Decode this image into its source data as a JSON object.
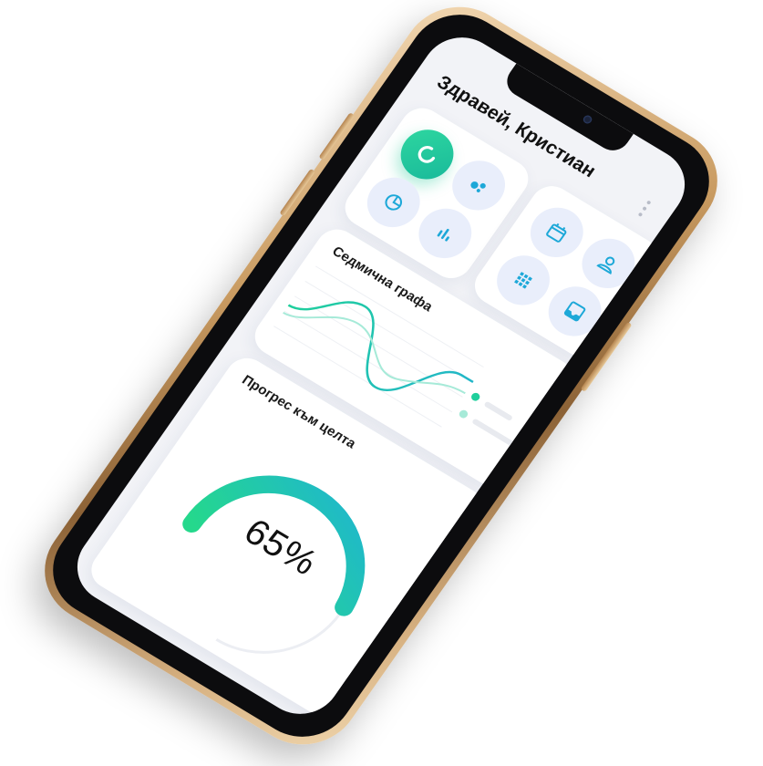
{
  "app": {
    "greeting": "Здравей, Кристиан"
  },
  "colors": {
    "accent_green": "#1fcf9c",
    "accent_teal": "#22b6c9",
    "icon_blue": "#1da8d8",
    "icon_bg": "#e9eefb",
    "frame_gold": "#c99b61"
  },
  "quick_actions_left": [
    {
      "icon": "donut-chart-icon",
      "active": true
    },
    {
      "icon": "bubbles-icon",
      "active": false
    },
    {
      "icon": "pie-chart-icon",
      "active": false
    },
    {
      "icon": "bar-chart-icon",
      "active": false
    }
  ],
  "quick_actions_right": [
    {
      "icon": "calendar-icon"
    },
    {
      "icon": "user-icon"
    },
    {
      "icon": "grid-icon"
    },
    {
      "icon": "inbox-icon"
    }
  ],
  "weekly_chart": {
    "title": "Седмична графа"
  },
  "goal_progress": {
    "title": "Прогрес към целта",
    "value_text": "65%",
    "value": 0.65
  }
}
